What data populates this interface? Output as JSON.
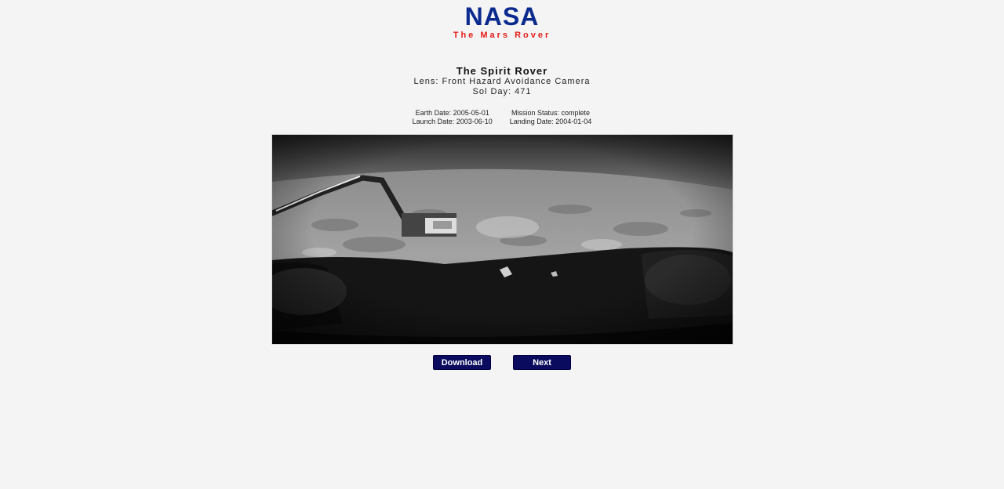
{
  "header": {
    "logo": "NASA",
    "subtitle": "The Mars Rover"
  },
  "rover": {
    "name": "The Spirit Rover",
    "lens": "Lens: Front Hazard Avoidance Camera",
    "sol": "Sol Day: 471"
  },
  "details": {
    "earth_date": "Earth Date: 2005-05-01",
    "launch_date": "Launch Date: 2003-06-10",
    "mission_status": "Mission Status: complete",
    "landing_date": "Landing Date: 2004-01-04"
  },
  "photo": {
    "subject": "rover-hazcam-photo"
  },
  "actions": {
    "download_label": "Download",
    "next_label": "Next"
  },
  "colors": {
    "logo": "#0b2a8f",
    "subtitle": "#e41b17",
    "button": "#0a0a5e",
    "background": "#f4f4f4"
  }
}
